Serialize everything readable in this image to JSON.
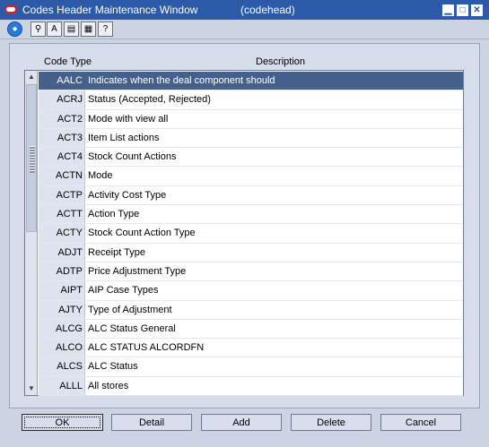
{
  "window": {
    "title": "Codes Header Maintenance Window",
    "code": "(codehead)",
    "controls": {
      "minimize": "▁",
      "maximize": "□",
      "close": "✕"
    }
  },
  "toolbar": {
    "items": [
      {
        "icon": "globe-icon",
        "glyph": "●"
      },
      {
        "icon": "search-icon",
        "glyph": "⚲"
      },
      {
        "icon": "font-icon",
        "glyph": "A"
      },
      {
        "icon": "clipboard-icon",
        "glyph": "▤"
      },
      {
        "icon": "document-icon",
        "glyph": "▦"
      },
      {
        "icon": "help-icon",
        "glyph": "?"
      }
    ]
  },
  "table": {
    "headers": {
      "code": "Code Type",
      "description": "Description"
    },
    "rows": [
      {
        "code": "AALC",
        "description": "Indicates when the deal component should",
        "selected": true
      },
      {
        "code": "ACRJ",
        "description": "Status (Accepted, Rejected)"
      },
      {
        "code": "ACT2",
        "description": "Mode with view all"
      },
      {
        "code": "ACT3",
        "description": "Item List actions"
      },
      {
        "code": "ACT4",
        "description": "Stock Count Actions"
      },
      {
        "code": "ACTN",
        "description": "Mode"
      },
      {
        "code": "ACTP",
        "description": "Activity Cost Type"
      },
      {
        "code": "ACTT",
        "description": "Action Type"
      },
      {
        "code": "ACTY",
        "description": "Stock Count Action Type"
      },
      {
        "code": "ADJT",
        "description": "Receipt Type"
      },
      {
        "code": "ADTP",
        "description": "Price Adjustment Type"
      },
      {
        "code": "AIPT",
        "description": "AIP Case Types"
      },
      {
        "code": "AJTY",
        "description": "Type of Adjustment"
      },
      {
        "code": "ALCG",
        "description": "ALC Status General"
      },
      {
        "code": "ALCO",
        "description": "ALC STATUS ALCORDFN"
      },
      {
        "code": "ALCS",
        "description": "ALC Status"
      },
      {
        "code": "ALLL",
        "description": "All stores"
      }
    ]
  },
  "scrollbar": {
    "up": "▲",
    "down": "▼"
  },
  "buttons": {
    "ok": "OK",
    "detail": "Detail",
    "add": "Add",
    "delete": "Delete",
    "cancel": "Cancel"
  }
}
